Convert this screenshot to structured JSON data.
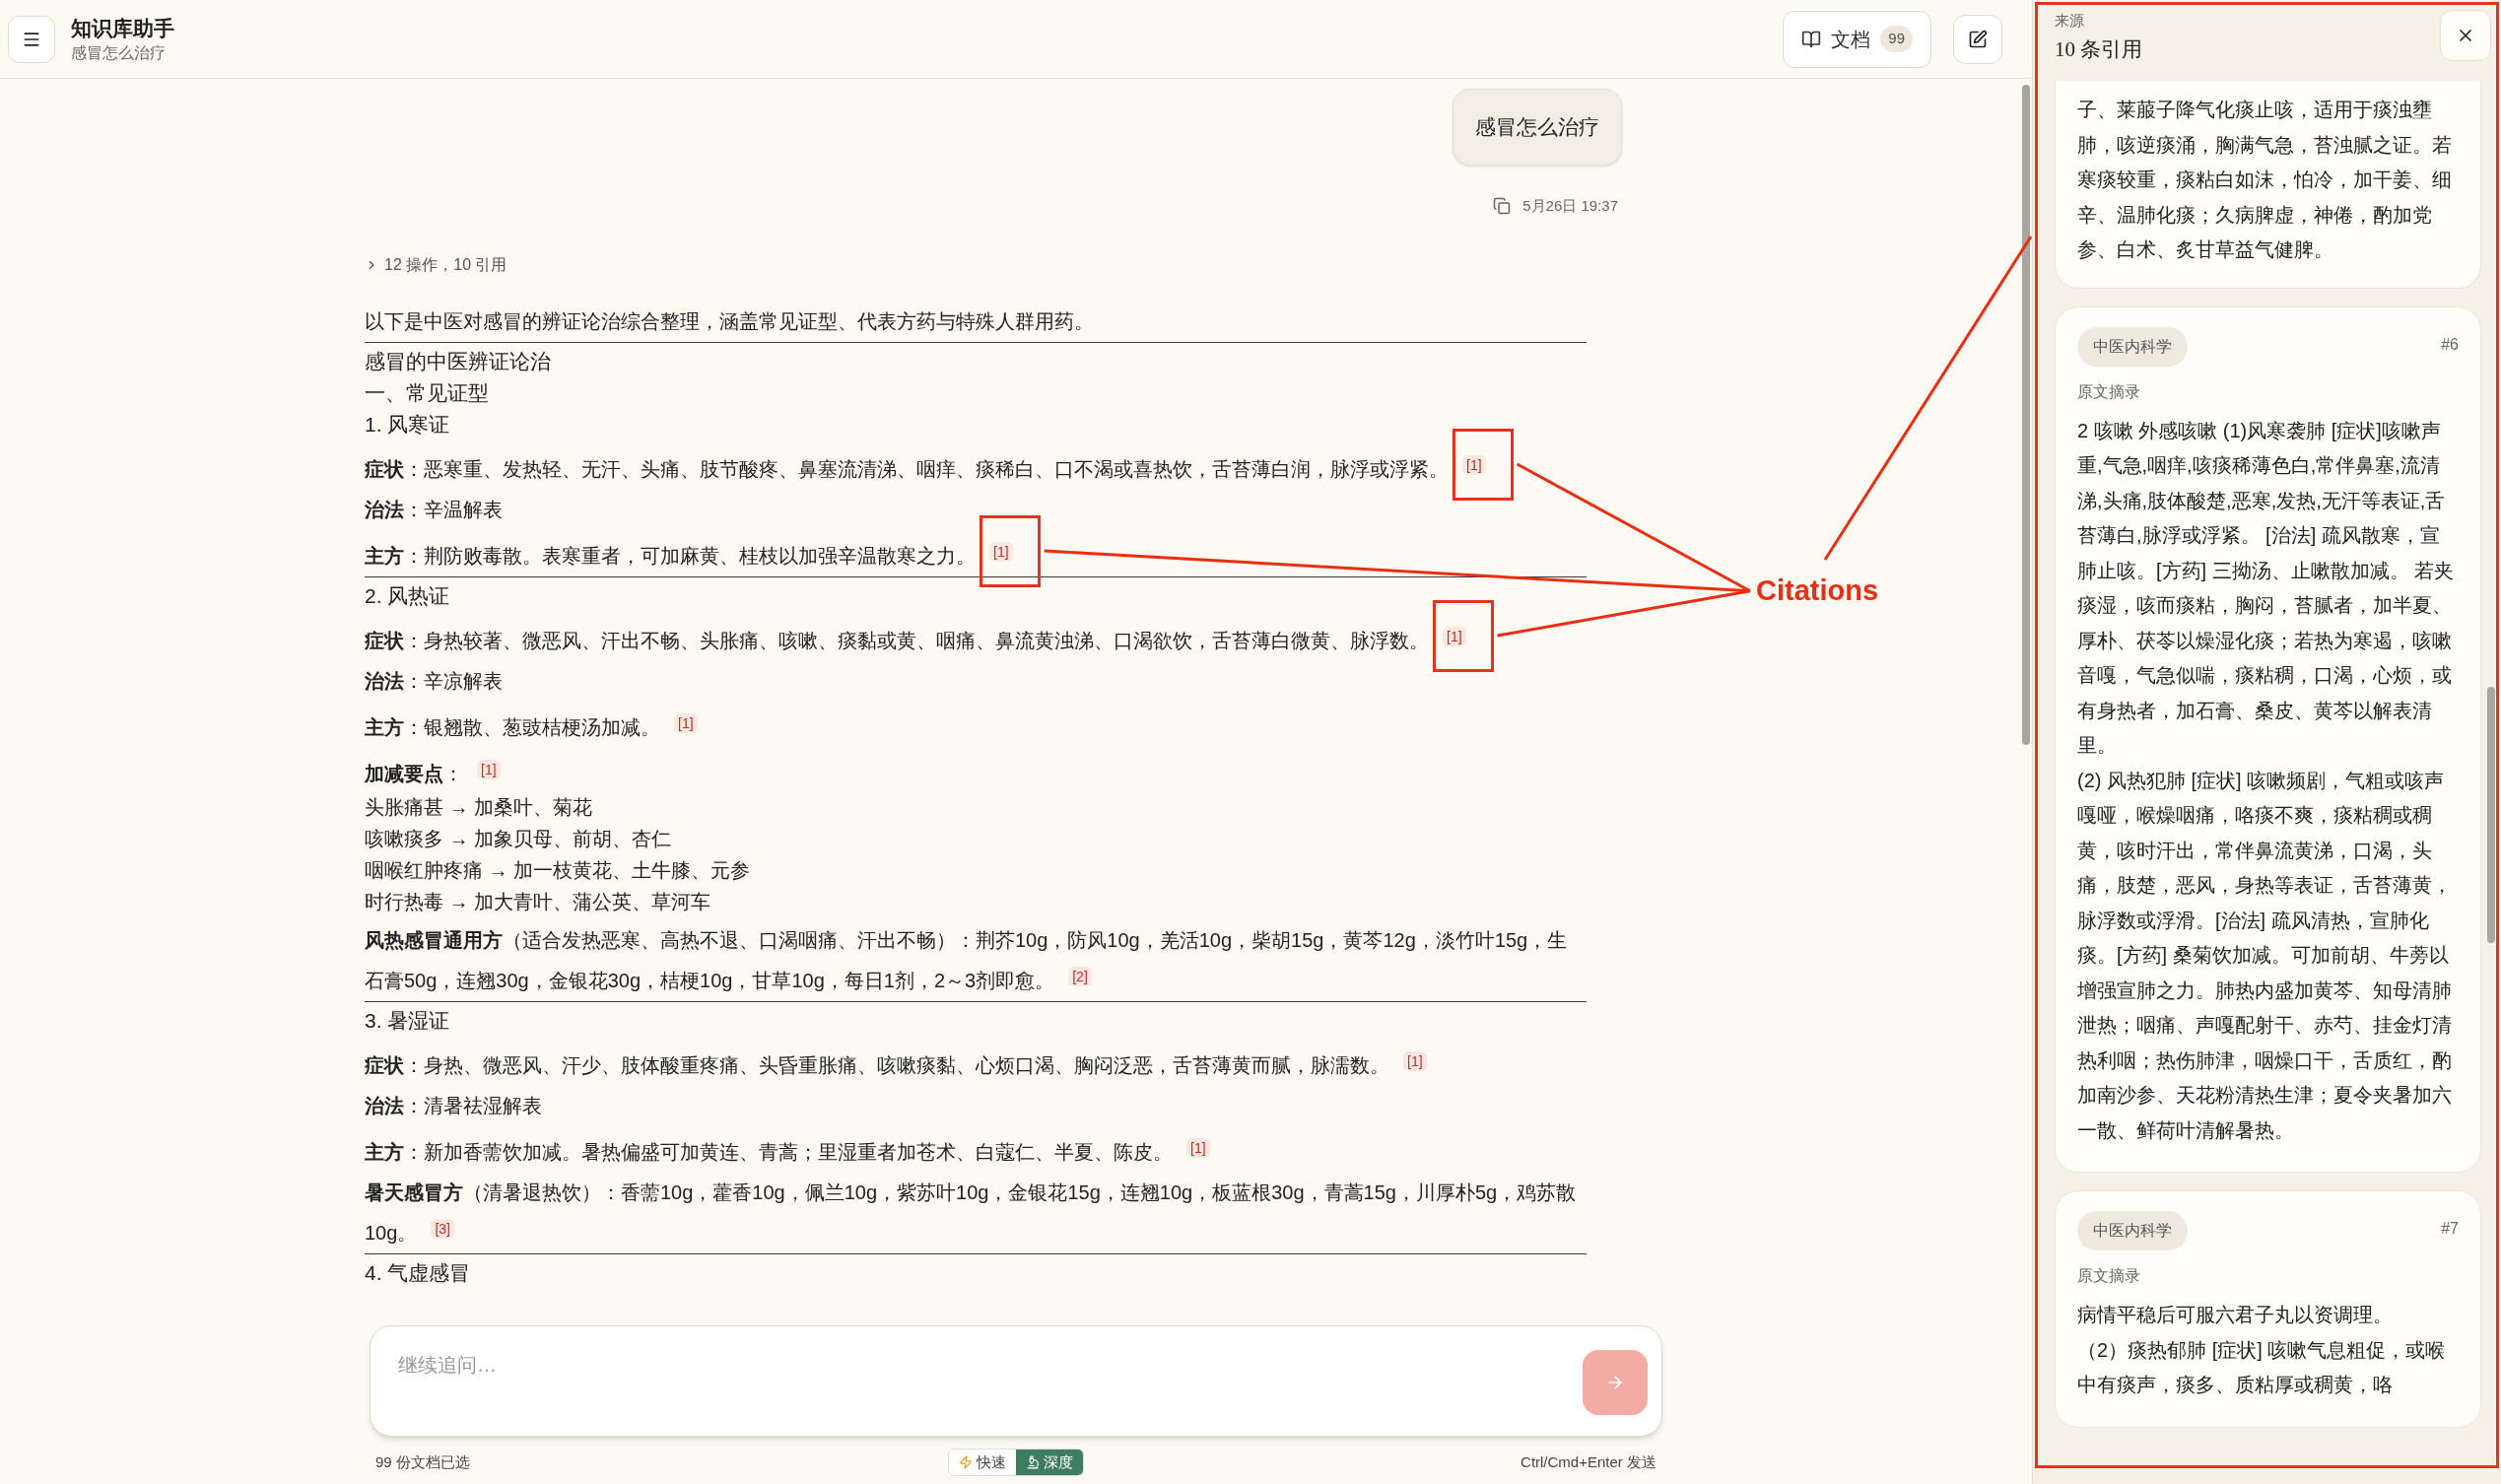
{
  "header": {
    "title": "知识库助手",
    "subtitle": "感冒怎么治疗",
    "docs_button": {
      "label": "文档",
      "count": "99"
    }
  },
  "conversation": {
    "question": "感冒怎么治疗",
    "timestamp": "5月26日 19:37",
    "answer": {
      "steps_summary": "12 操作，10 引用",
      "expanded": false,
      "intro": "以下是中医对感冒的辨证论治综合整理，涵盖常见证型、代表方药与特殊人群用药。",
      "blocks": [
        {
          "kind": "divider"
        },
        {
          "kind": "title",
          "text": "感冒的中医辨证论治"
        },
        {
          "kind": "section",
          "text": "一、常见证型"
        },
        {
          "kind": "subheading",
          "text": "1. 风寒证"
        },
        {
          "kind": "field",
          "label": "症状",
          "text": "：恶寒重、发热轻、无汗、头痛、肢节酸疼、鼻塞流清涕、咽痒、痰稀白、口不渴或喜热饮，舌苔薄白润，脉浮或浮紧。",
          "cite": "[1]",
          "annotated": true
        },
        {
          "kind": "field",
          "label": "治法",
          "text": "：辛温解表"
        },
        {
          "kind": "field",
          "label": "主方",
          "text": "：荆防败毒散。表寒重者，可加麻黄、桂枝以加强辛温散寒之力。",
          "cite": "[1]",
          "annotated": true
        },
        {
          "kind": "divider"
        },
        {
          "kind": "subheading",
          "text": "2. 风热证"
        },
        {
          "kind": "field",
          "label": "症状",
          "text": "：身热较著、微恶风、汗出不畅、头胀痛、咳嗽、痰黏或黄、咽痛、鼻流黄浊涕、口渴欲饮，舌苔薄白微黄、脉浮数。",
          "cite": "[1]",
          "annotated": true
        },
        {
          "kind": "field",
          "label": "治法",
          "text": "：辛凉解表"
        },
        {
          "kind": "field",
          "label": "主方",
          "text": "：银翘散、葱豉桔梗汤加减。",
          "cite": "[1]",
          "annotated": false
        },
        {
          "kind": "field",
          "label": "加减要点",
          "text": "：",
          "cite": "[1]",
          "annotated": false
        },
        {
          "kind": "item",
          "text": "头胀痛甚 → 加桑叶、菊花"
        },
        {
          "kind": "item",
          "text": "咳嗽痰多 → 加象贝母、前胡、杏仁"
        },
        {
          "kind": "item",
          "text": "咽喉红肿疼痛 → 加一枝黄花、土牛膝、元参"
        },
        {
          "kind": "item",
          "text": "时行热毒 → 加大青叶、蒲公英、草河车"
        },
        {
          "kind": "field",
          "label": "风热感冒通用方",
          "text": "（适合发热恶寒、高热不退、口渴咽痛、汗出不畅）：荆芥10g，防风10g，羌活10g，柴胡15g，黄芩12g，淡竹叶15g，生石膏50g，连翘30g，金银花30g，桔梗10g，甘草10g，每日1剂，2～3剂即愈。",
          "cite": "[2]",
          "annotated": false
        },
        {
          "kind": "divider"
        },
        {
          "kind": "subheading",
          "text": "3. 暑湿证"
        },
        {
          "kind": "field",
          "label": "症状",
          "text": "：身热、微恶风、汗少、肢体酸重疼痛、头昏重胀痛、咳嗽痰黏、心烦口渴、胸闷泛恶，舌苔薄黄而腻，脉濡数。",
          "cite": "[1]",
          "annotated": false
        },
        {
          "kind": "field",
          "label": "治法",
          "text": "：清暑祛湿解表"
        },
        {
          "kind": "field",
          "label": "主方",
          "text": "：新加香薷饮加减。暑热偏盛可加黄连、青蒿；里湿重者加苍术、白蔻仁、半夏、陈皮。",
          "cite": "[1]",
          "annotated": false
        },
        {
          "kind": "field",
          "label": "暑天感冒方",
          "text": "（清暑退热饮）：香薷10g，藿香10g，佩兰10g，紫苏叶10g，金银花15g，连翘10g，板蓝根30g，青蒿15g，川厚朴5g，鸡苏散10g。",
          "cite": "[3]",
          "annotated": false
        },
        {
          "kind": "divider"
        },
        {
          "kind": "subheading",
          "text": "4. 气虚感冒"
        }
      ]
    }
  },
  "composer": {
    "placeholder": "继续追问…",
    "selected_docs": "99 份文档已选",
    "modes": [
      {
        "kind": "fast",
        "label": "快速",
        "selected": false
      },
      {
        "kind": "deep",
        "label": "深度",
        "selected": true
      }
    ],
    "shortcut_hint": "Ctrl/Cmd+Enter 发送"
  },
  "sources_panel": {
    "label": "来源",
    "count_title": "10 条引用",
    "cards": [
      {
        "paragraphs": [
          "子、莱菔子降气化痰止咳，适用于痰浊壅肺，咳逆痰涌，胸满气急，苔浊腻之证。若寒痰较重，痰粘白如沫，怕冷，加干姜、细辛、温肺化痰；久病脾虚，神倦，酌加党参、白术、炙甘草益气健脾。"
        ]
      },
      {
        "tag": "中医内科学",
        "number": "#6",
        "excerpt_label": "原文摘录",
        "paragraphs": [
          "2 咳嗽 外感咳嗽 (1)风寒袭肺 [症状]咳嗽声重,气急,咽痒,咳痰稀薄色白,常伴鼻塞,流清涕,头痛,肢体酸楚,恶寒,发热,无汗等表证,舌苔薄白,脉浮或浮紧。 [治法] 疏风散寒，宣肺止咳。[方药] 三拗汤、止嗽散加减。 若夹痰湿，咳而痰粘，胸闷，苔腻者，加半夏、厚朴、茯苓以燥湿化痰；若热为寒遏，咳嗽音嘎，气急似喘，痰粘稠，口渴，心烦，或有身热者，加石膏、桑皮、黄芩以解表清里。",
          "(2) 风热犯肺 [症状] 咳嗽频剧，气粗或咳声嘎哑，喉燥咽痛，咯痰不爽，痰粘稠或稠黄，咳时汗出，常伴鼻流黄涕，口渴，头痛，肢楚，恶风，身热等表证，舌苔薄黄，脉浮数或浮滑。[治法] 疏风清热，宣肺化痰。[方药] 桑菊饮加减。可加前胡、牛蒡以增强宣肺之力。肺热内盛加黄芩、知母清肺泄热；咽痛、声嘎配射干、赤芍、挂金灯清热利咽；热伤肺津，咽燥口干，舌质红，酌加南沙参、天花粉清热生津；夏令夹暑加六一散、鲜荷叶清解暑热。"
        ]
      },
      {
        "tag": "中医内科学",
        "number": "#7",
        "excerpt_label": "原文摘录",
        "paragraphs": [
          "病情平稳后可服六君子丸以资调理。",
          "（2）痰热郁肺 [症状] 咳嗽气息粗促，或喉中有痰声，痰多、质粘厚或稠黄，咯"
        ]
      }
    ]
  },
  "annotation": {
    "label": "Citations"
  }
}
